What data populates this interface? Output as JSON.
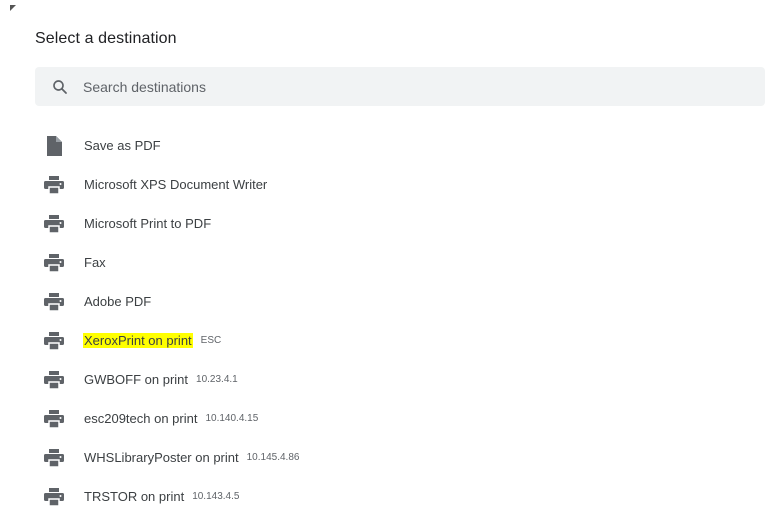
{
  "dialog": {
    "title": "Select a destination",
    "search": {
      "placeholder": "Search destinations",
      "value": ""
    },
    "destinations": [
      {
        "label": "Save as PDF",
        "subtext": "",
        "icon": "file-icon"
      },
      {
        "label": "Microsoft XPS Document Writer",
        "subtext": "",
        "icon": "printer-icon"
      },
      {
        "label": "Microsoft Print to PDF",
        "subtext": "",
        "icon": "printer-icon"
      },
      {
        "label": "Fax",
        "subtext": "",
        "icon": "printer-icon"
      },
      {
        "label": "Adobe PDF",
        "subtext": "",
        "icon": "printer-icon"
      },
      {
        "label": "XeroxPrint on print",
        "subtext": "ESC",
        "icon": "printer-icon",
        "highlighted": true,
        "highlight_color": "#ffff00"
      },
      {
        "label": "GWBOFF on print",
        "subtext": "10.23.4.1",
        "icon": "printer-icon"
      },
      {
        "label": "esc209tech on print",
        "subtext": "10.140.4.15",
        "icon": "printer-icon"
      },
      {
        "label": "WHSLibraryPoster on print",
        "subtext": "10.145.4.86",
        "icon": "printer-icon"
      },
      {
        "label": "TRSTOR on print",
        "subtext": "10.143.4.5",
        "icon": "printer-icon"
      }
    ]
  },
  "colors": {
    "icon": "#5f6368",
    "search_bg": "#f1f3f4",
    "text": "#3c4043"
  }
}
